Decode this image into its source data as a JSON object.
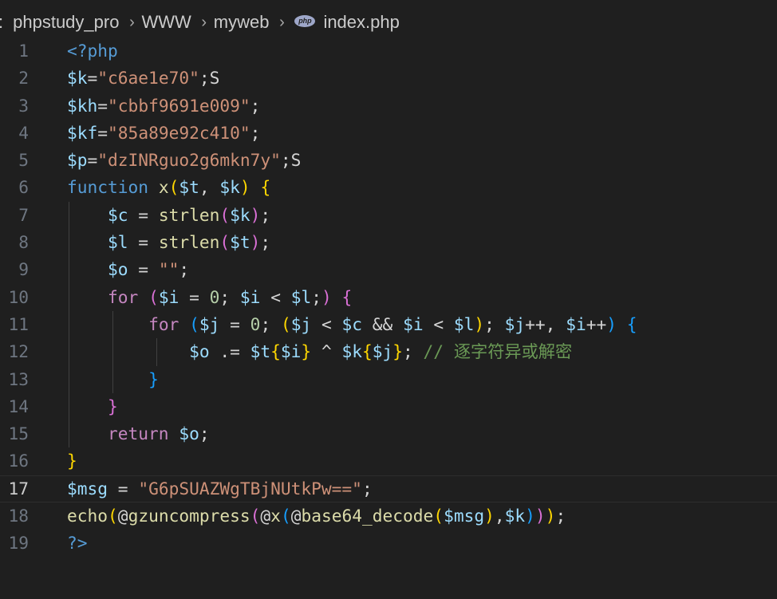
{
  "breadcrumb": {
    "items": [
      ":",
      "phpstudy_pro",
      "WWW",
      "myweb",
      "index.php"
    ],
    "file_icon": "php"
  },
  "editor": {
    "active_line": 17,
    "lines": [
      {
        "n": "1",
        "tokens": [
          [
            "tag",
            "<?php"
          ]
        ]
      },
      {
        "n": "2",
        "tokens": [
          [
            "var",
            "$k"
          ],
          [
            "op",
            "="
          ],
          [
            "str",
            "\"c6ae1e70\""
          ],
          [
            "op",
            ";S"
          ]
        ]
      },
      {
        "n": "3",
        "tokens": [
          [
            "var",
            "$kh"
          ],
          [
            "op",
            "="
          ],
          [
            "str",
            "\"cbbf9691e009\""
          ],
          [
            "op",
            ";"
          ]
        ]
      },
      {
        "n": "4",
        "tokens": [
          [
            "var",
            "$kf"
          ],
          [
            "op",
            "="
          ],
          [
            "str",
            "\"85a89e92c410\""
          ],
          [
            "op",
            ";"
          ]
        ]
      },
      {
        "n": "5",
        "tokens": [
          [
            "var",
            "$p"
          ],
          [
            "op",
            "="
          ],
          [
            "str",
            "\"dzINRguo2g6mkn7y\""
          ],
          [
            "op",
            ";S"
          ]
        ]
      },
      {
        "n": "6",
        "tokens": [
          [
            "kw",
            "function"
          ],
          [
            "op",
            " "
          ],
          [
            "fn",
            "x"
          ],
          [
            "b1",
            "("
          ],
          [
            "var",
            "$t"
          ],
          [
            "op",
            ", "
          ],
          [
            "var",
            "$k"
          ],
          [
            "b1",
            ")"
          ],
          [
            "op",
            " "
          ],
          [
            "b1",
            "{"
          ]
        ]
      },
      {
        "n": "7",
        "tokens": [
          [
            "op",
            "    "
          ],
          [
            "var",
            "$c"
          ],
          [
            "op",
            " = "
          ],
          [
            "fn",
            "strlen"
          ],
          [
            "b2",
            "("
          ],
          [
            "var",
            "$k"
          ],
          [
            "b2",
            ")"
          ],
          [
            "op",
            ";"
          ]
        ]
      },
      {
        "n": "8",
        "tokens": [
          [
            "op",
            "    "
          ],
          [
            "var",
            "$l"
          ],
          [
            "op",
            " = "
          ],
          [
            "fn",
            "strlen"
          ],
          [
            "b2",
            "("
          ],
          [
            "var",
            "$t"
          ],
          [
            "b2",
            ")"
          ],
          [
            "op",
            ";"
          ]
        ]
      },
      {
        "n": "9",
        "tokens": [
          [
            "op",
            "    "
          ],
          [
            "var",
            "$o"
          ],
          [
            "op",
            " = "
          ],
          [
            "str",
            "\"\""
          ],
          [
            "op",
            ";"
          ]
        ]
      },
      {
        "n": "10",
        "tokens": [
          [
            "op",
            "    "
          ],
          [
            "ctl",
            "for"
          ],
          [
            "op",
            " "
          ],
          [
            "b2",
            "("
          ],
          [
            "var",
            "$i"
          ],
          [
            "op",
            " = "
          ],
          [
            "num",
            "0"
          ],
          [
            "op",
            "; "
          ],
          [
            "var",
            "$i"
          ],
          [
            "op",
            " < "
          ],
          [
            "var",
            "$l"
          ],
          [
            "op",
            ";"
          ],
          [
            "b2",
            ")"
          ],
          [
            "op",
            " "
          ],
          [
            "b2",
            "{"
          ]
        ]
      },
      {
        "n": "11",
        "tokens": [
          [
            "op",
            "        "
          ],
          [
            "ctl",
            "for"
          ],
          [
            "op",
            " "
          ],
          [
            "b3",
            "("
          ],
          [
            "var",
            "$j"
          ],
          [
            "op",
            " = "
          ],
          [
            "num",
            "0"
          ],
          [
            "op",
            "; "
          ],
          [
            "b1",
            "("
          ],
          [
            "var",
            "$j"
          ],
          [
            "op",
            " < "
          ],
          [
            "var",
            "$c"
          ],
          [
            "op",
            " && "
          ],
          [
            "var",
            "$i"
          ],
          [
            "op",
            " < "
          ],
          [
            "var",
            "$l"
          ],
          [
            "b1",
            ")"
          ],
          [
            "op",
            "; "
          ],
          [
            "var",
            "$j"
          ],
          [
            "op",
            "++, "
          ],
          [
            "var",
            "$i"
          ],
          [
            "op",
            "++"
          ],
          [
            "b3",
            ")"
          ],
          [
            "op",
            " "
          ],
          [
            "b3",
            "{"
          ]
        ]
      },
      {
        "n": "12",
        "tokens": [
          [
            "op",
            "            "
          ],
          [
            "var",
            "$o"
          ],
          [
            "op",
            " .= "
          ],
          [
            "var",
            "$t"
          ],
          [
            "b1",
            "{"
          ],
          [
            "var",
            "$i"
          ],
          [
            "b1",
            "}"
          ],
          [
            "op",
            " ^ "
          ],
          [
            "var",
            "$k"
          ],
          [
            "b1",
            "{"
          ],
          [
            "var",
            "$j"
          ],
          [
            "b1",
            "}"
          ],
          [
            "op",
            "; "
          ],
          [
            "cm",
            "// 逐字符异或解密"
          ]
        ]
      },
      {
        "n": "13",
        "tokens": [
          [
            "op",
            "        "
          ],
          [
            "b3",
            "}"
          ]
        ]
      },
      {
        "n": "14",
        "tokens": [
          [
            "op",
            "    "
          ],
          [
            "b2",
            "}"
          ]
        ]
      },
      {
        "n": "15",
        "tokens": [
          [
            "op",
            "    "
          ],
          [
            "ctl",
            "return"
          ],
          [
            "op",
            " "
          ],
          [
            "var",
            "$o"
          ],
          [
            "op",
            ";"
          ]
        ]
      },
      {
        "n": "16",
        "tokens": [
          [
            "b1",
            "}"
          ]
        ]
      },
      {
        "n": "17",
        "tokens": [
          [
            "var",
            "$msg"
          ],
          [
            "op",
            " = "
          ],
          [
            "str",
            "\"G6pSUAZWgTBjNUtkPw==\""
          ],
          [
            "op",
            ";"
          ]
        ]
      },
      {
        "n": "18",
        "tokens": [
          [
            "fn",
            "echo"
          ],
          [
            "b1",
            "("
          ],
          [
            "op",
            "@"
          ],
          [
            "fn",
            "gzuncompress"
          ],
          [
            "b2",
            "("
          ],
          [
            "op",
            "@"
          ],
          [
            "fn",
            "x"
          ],
          [
            "b3",
            "("
          ],
          [
            "op",
            "@"
          ],
          [
            "fn",
            "base64_decode"
          ],
          [
            "b1",
            "("
          ],
          [
            "var",
            "$msg"
          ],
          [
            "b1",
            ")"
          ],
          [
            "op",
            ","
          ],
          [
            "var",
            "$k"
          ],
          [
            "b3",
            ")"
          ],
          [
            "b2",
            ")"
          ],
          [
            "b1",
            ")"
          ],
          [
            "op",
            ";"
          ]
        ]
      },
      {
        "n": "19",
        "tokens": [
          [
            "tag",
            "?>"
          ]
        ]
      }
    ]
  }
}
